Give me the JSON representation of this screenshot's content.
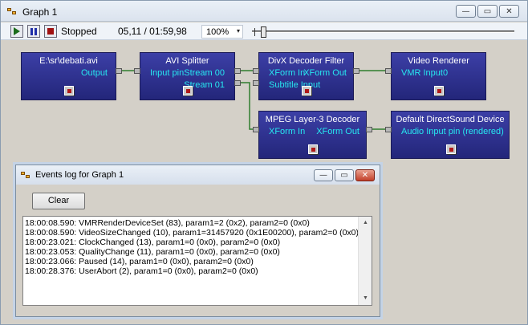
{
  "window": {
    "title": "Graph 1",
    "caption": {
      "minimize": "—",
      "maximize": "▭",
      "close": "✕"
    }
  },
  "toolbar": {
    "state": "Stopped",
    "time": "05,11 / 01:59,98",
    "zoom": "100%",
    "zoom_arrow": "▾",
    "seek_position_fraction": 0.035
  },
  "filters": [
    {
      "name": "E:\\sr\\debati.avi",
      "pins": [
        "Output"
      ]
    },
    {
      "name": "AVI Splitter",
      "pins": [
        "Input pin",
        "Stream 00",
        "Stream 01"
      ]
    },
    {
      "name": "DivX Decoder Filter",
      "pins": [
        "XForm In",
        "XForm Out",
        "Subtitle Input"
      ]
    },
    {
      "name": "Video Renderer",
      "pins": [
        "VMR Input0"
      ]
    },
    {
      "name": "MPEG Layer-3 Decoder",
      "pins": [
        "XForm In",
        "XForm Out"
      ]
    },
    {
      "name": "Default DirectSound Device",
      "pins": [
        "Audio Input pin (rendered)"
      ]
    }
  ],
  "events_dialog": {
    "title": "Events log for Graph 1",
    "clear_label": "Clear",
    "log": [
      "18:00:08.590: VMRRenderDeviceSet (83), param1=2 (0x2), param2=0 (0x0)",
      "18:00:08.590: VideoSizeChanged (10), param1=31457920 (0x1E00200), param2=0 (0x0)",
      "18:00:23.021: ClockChanged (13), param1=0 (0x0), param2=0 (0x0)",
      "18:00:23.053: QualityChange (11), param1=0 (0x0), param2=0 (0x0)",
      "18:00:23.066: Paused (14), param1=0 (0x0), param2=0 (0x0)",
      "18:00:28.376: UserAbort (2), param1=0 (0x0), param2=0 (0x0)"
    ]
  },
  "colors": {
    "filter_fill": "#2f3290",
    "pin_text": "#26e8f0",
    "wire": "#2e7d2e"
  }
}
